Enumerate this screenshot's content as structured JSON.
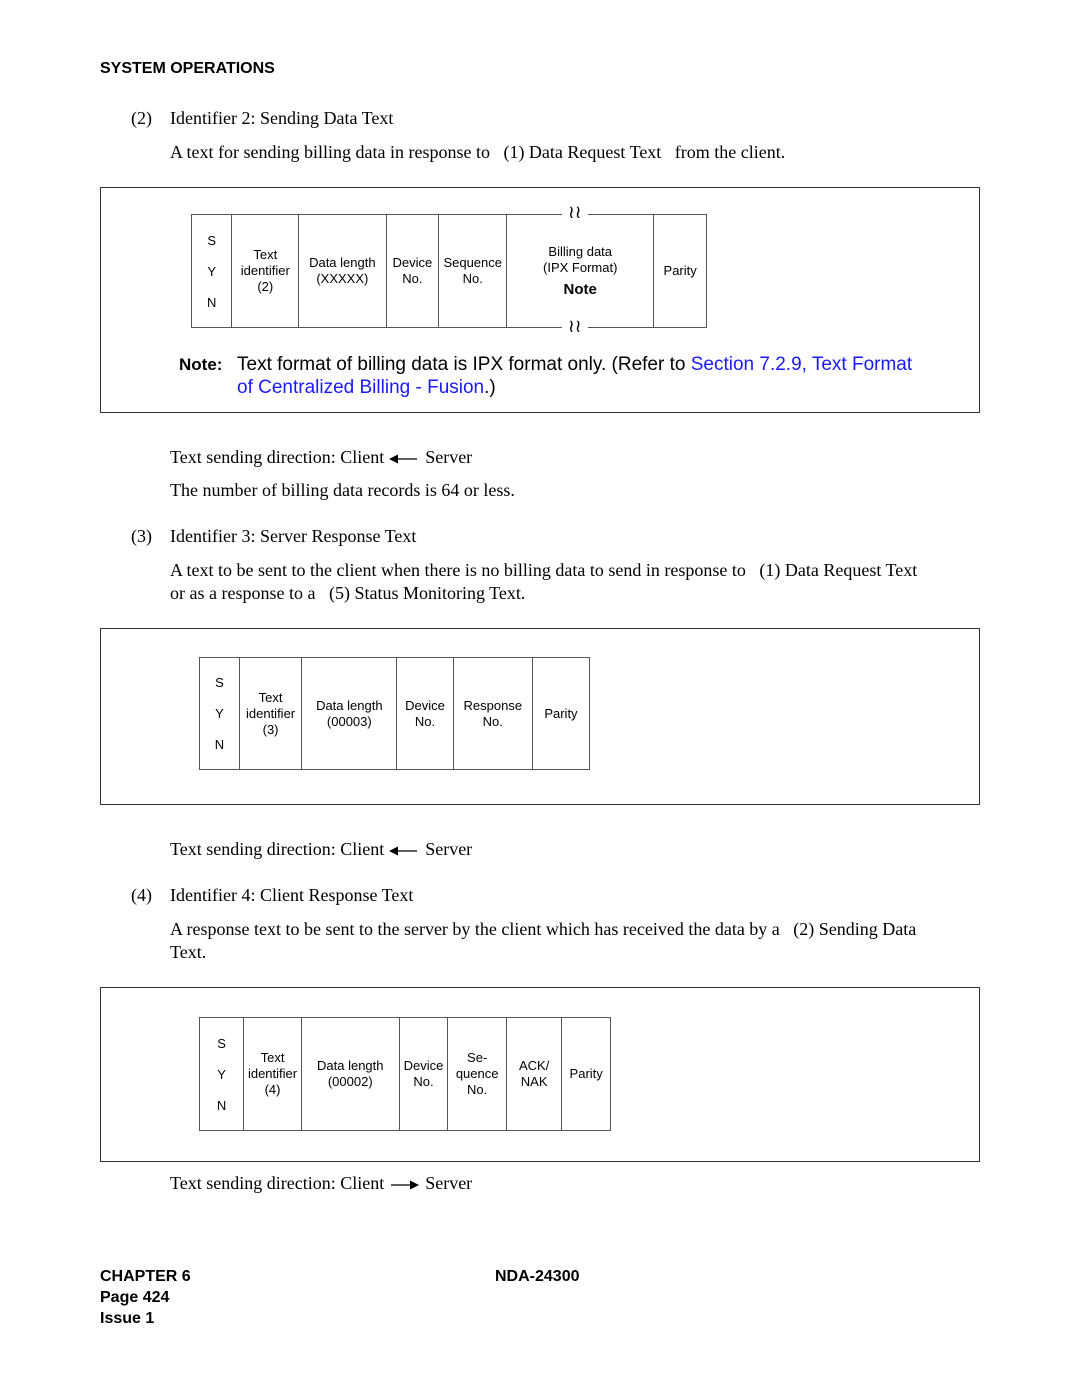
{
  "header": {
    "section_title": "SYSTEM OPERATIONS"
  },
  "section2": {
    "number": "(2)",
    "title": "Identifier 2: Sending Data Text",
    "description": "A text for sending billing data in response to   (1) Data Request Text   from the client.",
    "table": {
      "syn": [
        "S",
        "Y",
        "N"
      ],
      "cells": [
        {
          "lines": [
            "Text",
            "identifier",
            "(2)"
          ]
        },
        {
          "lines": [
            "Data length",
            "(XXXXX)"
          ]
        },
        {
          "lines": [
            "Device",
            "No."
          ]
        },
        {
          "lines": [
            "Sequence",
            "No."
          ]
        },
        {
          "lines": [
            "Billing data",
            "(IPX Format)"
          ],
          "note": "Note"
        },
        {
          "lines": [
            "Parity"
          ]
        }
      ]
    },
    "note": {
      "label": "Note:",
      "text": "Text format of billing data is IPX format only. (Refer to ",
      "link_text_line1": "Section 7.2.9, Text Format",
      "link_text_line2": "of Centralized Billing - Fusion",
      "closing": ".)"
    },
    "direction": {
      "prefix": "Text sending direction: Client",
      "arrow": "left-arrow",
      "suffix": "Server"
    },
    "records_note": "The number of billing data records is 64 or less."
  },
  "section3": {
    "number": "(3)",
    "title": "Identifier 3: Server Response Text",
    "description_line1": "A text to be sent to the client when there is no billing data to send in response to   (1) Data Request Text",
    "description_line2": "or as a response to a   (5) Status Monitoring Text.",
    "table": {
      "syn": [
        "S",
        "Y",
        "N"
      ],
      "cells": [
        {
          "lines": [
            "Text",
            "identifier",
            "(3)"
          ]
        },
        {
          "lines": [
            "Data length",
            "(00003)"
          ]
        },
        {
          "lines": [
            "Device",
            "No."
          ]
        },
        {
          "lines": [
            "Response",
            "No."
          ]
        },
        {
          "lines": [
            "Parity"
          ]
        }
      ]
    },
    "direction": {
      "prefix": "Text sending direction: Client",
      "arrow": "left-arrow",
      "suffix": "Server"
    }
  },
  "section4": {
    "number": "(4)",
    "title": "Identifier 4: Client Response Text",
    "description_line1": "A response text to be sent to the server by the client which has received the data by a   (2) Sending Data",
    "description_line2": "Text.",
    "table": {
      "syn": [
        "S",
        "Y",
        "N"
      ],
      "cells": [
        {
          "lines": [
            "Text",
            "identifier",
            "(4)"
          ]
        },
        {
          "lines": [
            "Data length",
            "(00002)"
          ]
        },
        {
          "lines": [
            "Device",
            "No."
          ]
        },
        {
          "lines": [
            "Se-",
            "quence",
            "No."
          ]
        },
        {
          "lines": [
            "ACK/",
            "NAK"
          ]
        },
        {
          "lines": [
            "Parity"
          ]
        }
      ]
    },
    "direction": {
      "prefix": "Text sending direction: Client",
      "arrow": "right-arrow",
      "suffix": "Server"
    }
  },
  "footer": {
    "chapter": "CHAPTER 6",
    "page": "Page 424",
    "issue": "Issue 1",
    "doc_number": "NDA-24300"
  },
  "wave_symbol": "≀≀"
}
